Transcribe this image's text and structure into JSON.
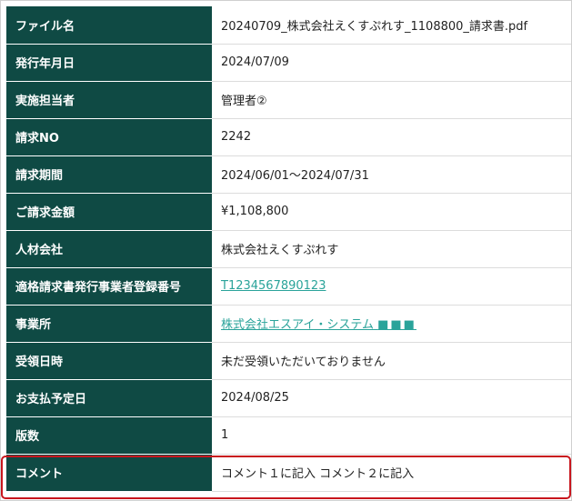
{
  "rows": [
    {
      "label": "ファイル名",
      "value": "20240709_株式会社えくすぷれす_1108800_請求書.pdf"
    },
    {
      "label": "発行年月日",
      "value": "2024/07/09"
    },
    {
      "label": "実施担当者",
      "value": "管理者②"
    },
    {
      "label": "請求NO",
      "value": "2242"
    },
    {
      "label": "請求期間",
      "value": "2024/06/01～2024/07/31"
    },
    {
      "label": "ご請求金額",
      "value": "¥1,108,800"
    },
    {
      "label": "人材会社",
      "value": "株式会社えくすぷれす"
    },
    {
      "label": "適格請求書発行事業者登録番号",
      "value": "T1234567890123"
    },
    {
      "label": "事業所",
      "value": "株式会社エスアイ・システム",
      "suffix": "■■■"
    },
    {
      "label": "受領日時",
      "value": "未だ受領いただいておりません"
    },
    {
      "label": "お支払予定日",
      "value": "2024/08/25"
    },
    {
      "label": "版数",
      "value": "1"
    },
    {
      "label": "コメント",
      "value": "コメント１に記入 コメント２に記入"
    }
  ],
  "colors": {
    "header_bg": "#0f4a44",
    "link": "#2aa39a",
    "highlight_border": "#c8161d"
  }
}
